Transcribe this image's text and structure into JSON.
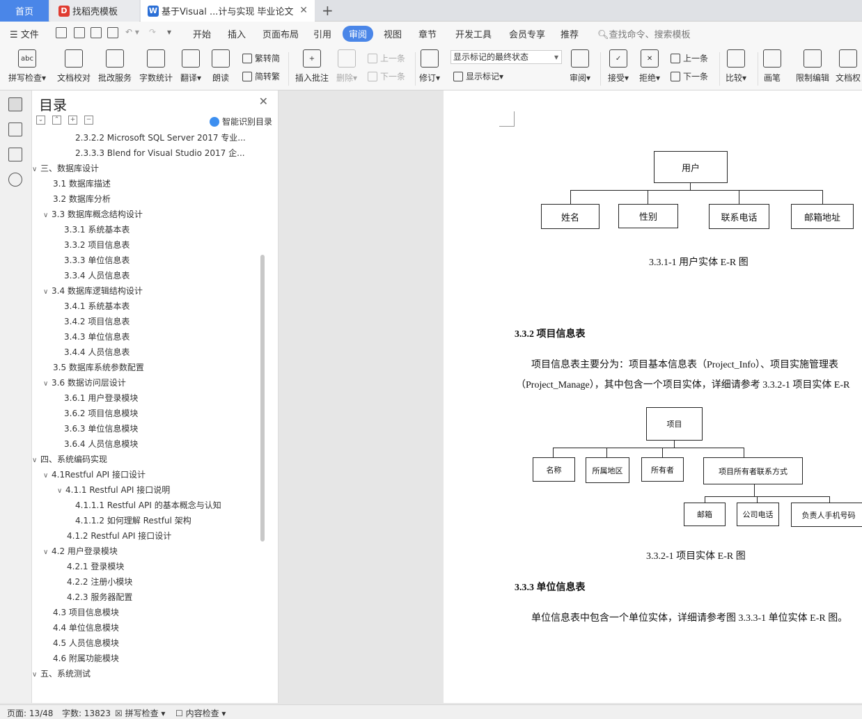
{
  "tabs": {
    "home": "首页",
    "templates": "找稻壳模板",
    "doc": "基于Visual ...计与实现 毕业论文"
  },
  "menu": {
    "file": "文件",
    "items": [
      "开始",
      "插入",
      "页面布局",
      "引用",
      "审阅",
      "视图",
      "章节",
      "开发工具",
      "会员专享",
      "推荐"
    ],
    "active": "审阅",
    "search": "查找命令、搜索模板"
  },
  "toolbar": {
    "spell": "拼写检查",
    "proof": "文档校对",
    "batch": "批改服务",
    "wordcount": "字数统计",
    "translate": "翻译",
    "read": "朗读",
    "trad": "繁转简",
    "simp": "简转繁",
    "insert_comment": "插入批注",
    "delete": "删除",
    "prev_c": "上一条",
    "next_c": "下一条",
    "track": "修订",
    "markup_state": "显示标记的最终状态",
    "show_markup": "显示标记",
    "review": "审阅",
    "accept": "接受",
    "reject": "拒绝",
    "prev": "上一条",
    "next": "下一条",
    "compare": "比较",
    "pen": "画笔",
    "restrict": "限制编辑",
    "docperm": "文档权"
  },
  "nav": {
    "title": "目录",
    "smart": "智能识别目录",
    "items": [
      {
        "text": "2.3.2.2 Microsoft SQL Server 2017  专业...",
        "level": 4
      },
      {
        "text": "2.3.3.3 Blend for Visual Studio 2017  企...",
        "level": 4
      },
      {
        "text": "三、数据库设计",
        "level": 1,
        "open": true
      },
      {
        "text": "3.1 数据库描述",
        "level": 2
      },
      {
        "text": "3.2 数据库分析",
        "level": 2
      },
      {
        "text": "3.3 数据库概念结构设计",
        "level": 2,
        "open": true
      },
      {
        "text": "3.3.1 系统基本表",
        "level": 3
      },
      {
        "text": "3.3.2 项目信息表",
        "level": 3
      },
      {
        "text": "3.3.3 单位信息表",
        "level": 3
      },
      {
        "text": "3.3.4 人员信息表",
        "level": 3
      },
      {
        "text": "3.4 数据库逻辑结构设计",
        "level": 2,
        "open": true
      },
      {
        "text": "3.4.1 系统基本表",
        "level": 3
      },
      {
        "text": "3.4.2 项目信息表",
        "level": 3
      },
      {
        "text": "3.4.3 单位信息表",
        "level": 3
      },
      {
        "text": "3.4.4 人员信息表",
        "level": 3
      },
      {
        "text": "3.5 数据库系统参数配置",
        "level": 2
      },
      {
        "text": "3.6 数据访问层设计",
        "level": 2,
        "open": true
      },
      {
        "text": "3.6.1  用户登录模块",
        "level": 3
      },
      {
        "text": "3.6.2  项目信息模块",
        "level": 3
      },
      {
        "text": "3.6.3  单位信息模块",
        "level": 3
      },
      {
        "text": "3.6.4  人员信息模块",
        "level": 3
      },
      {
        "text": "四、系统编码实现",
        "level": 1,
        "open": true
      },
      {
        "text": "4.1Restful API 接口设计",
        "level": 2,
        "open": true
      },
      {
        "text": "4.1.1 Restful API 接口说明",
        "level": 3,
        "open": true,
        "indent": 4
      },
      {
        "text": "4.1.1.1 Restful API 的基本概念与认知",
        "level": 4
      },
      {
        "text": "4.1.1.2  如何理解 Restful 架构",
        "level": 4
      },
      {
        "text": "4.1.2 Restful API 接口设计",
        "level": 3,
        "indent": 4
      },
      {
        "text": "4.2 用户登录模块",
        "level": 2,
        "open": true
      },
      {
        "text": "4.2.1 登录模块",
        "level": 3,
        "indent": 4
      },
      {
        "text": "4.2.2 注册小模块",
        "level": 3,
        "indent": 4
      },
      {
        "text": "4.2.3 服务器配置",
        "level": 3,
        "indent": 4
      },
      {
        "text": "4.3 项目信息模块",
        "level": 2
      },
      {
        "text": "4.4 单位信息模块",
        "level": 2
      },
      {
        "text": "4.5 人员信息模块",
        "level": 2
      },
      {
        "text": "4.6 附属功能模块",
        "level": 2
      },
      {
        "text": "五、系统测试",
        "level": 1,
        "open": true
      }
    ]
  },
  "doc": {
    "er1": {
      "entity": "用户",
      "attrs": [
        "姓名",
        "性别",
        "联系电话",
        "邮箱地址"
      ],
      "caption": "3.3.1-1 用户实体 E-R 图"
    },
    "h332": "3.3.2 项目信息表",
    "p332a": "项目信息表主要分为：项目基本信息表（Project_Info）、项目实施管理表",
    "p332b": "（Project_Manage），其中包含一个项目实体，详细请参考 3.3.2-1 项目实体 E-R",
    "er2": {
      "entity": "项目",
      "attrs": [
        "名称",
        "所属地区",
        "所有者",
        "项目所有者联系方式"
      ],
      "sub": [
        "邮箱",
        "公司电话",
        "负责人手机号码"
      ],
      "caption": "3.3.2-1 项目实体 E-R 图"
    },
    "h333": "3.3.3 单位信息表",
    "p333": "单位信息表中包含一个单位实体，详细请参考图 3.3.3-1 单位实体 E-R 图。"
  },
  "status": {
    "page": "页面: 13/48",
    "words": "字数: 13823",
    "spell": "拼写检查",
    "content": "内容检查"
  }
}
